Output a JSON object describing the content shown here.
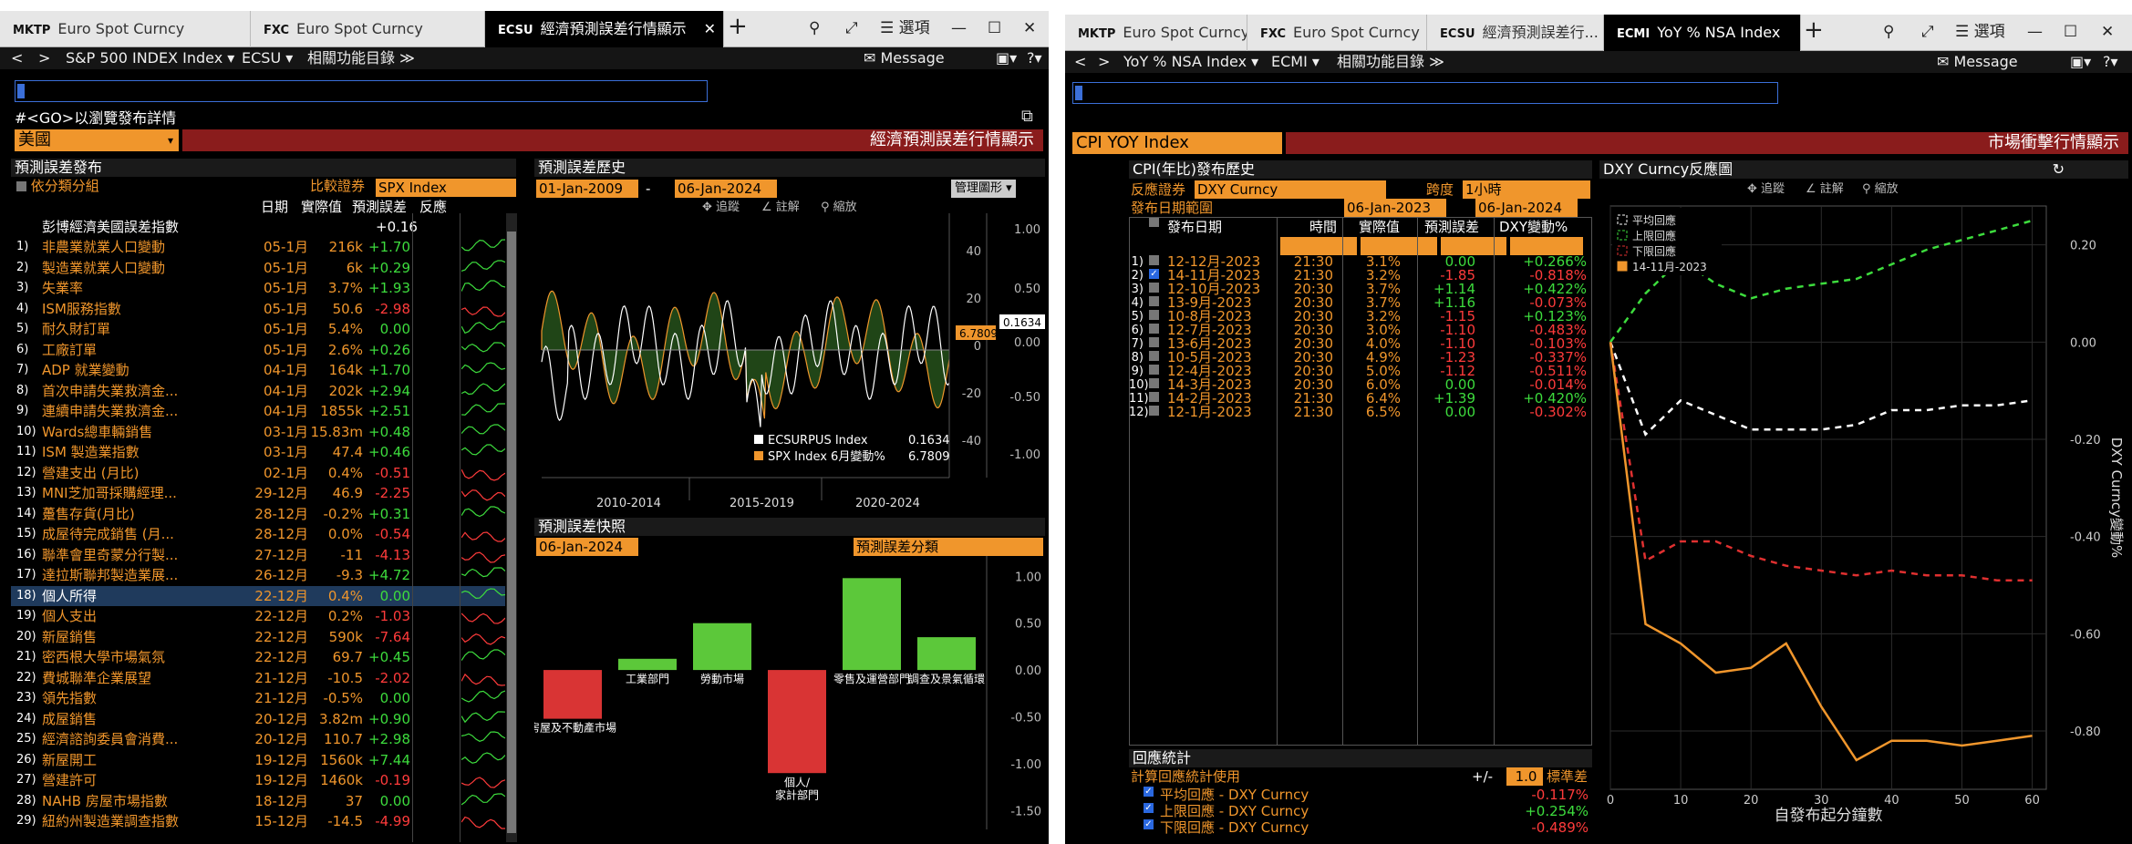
{
  "left": {
    "tabs": [
      {
        "code": "MKTP",
        "label": "Euro Spot Curncy"
      },
      {
        "code": "FXC",
        "label": "Euro Spot Curncy"
      },
      {
        "code": "ECSU",
        "label": "經濟預測誤差行情顯示"
      }
    ],
    "controls": {
      "search": "⚲",
      "expand": "⤢",
      "options": "☰ 選項",
      "min": "—",
      "max": "☐",
      "close": "✕"
    },
    "nav": {
      "back": "<",
      "fwd": ">",
      "security": "S&P 500 INDEX Index ▾",
      "fn": "ECSU ▾",
      "related": "相關功能目錄 ≫",
      "message": "✉ Message",
      "tools": "▣▾",
      "help": "?▾"
    },
    "hint": "#<GO>以瀏覽發布詳情",
    "country": "美國",
    "title": "經濟預測誤差行情顯示",
    "release_header": "預測誤差發布",
    "group_by": "依分類分組",
    "compare_label": "比較證券",
    "compare_value": "SPX Index",
    "columns": {
      "date": "日期",
      "actual": "實際值",
      "surprise": "預測誤差",
      "reaction": "反應"
    },
    "index_row": {
      "name": "彭博經濟美國誤差指數",
      "surprise": "+0.16"
    },
    "rows": [
      {
        "n": "1)",
        "name": "非農業就業人口變動",
        "date": "05-1月",
        "actual": "216k",
        "s": "+1.70",
        "c": "g"
      },
      {
        "n": "2)",
        "name": "製造業就業人口變動",
        "date": "05-1月",
        "actual": "6k",
        "s": "+0.29",
        "c": "g"
      },
      {
        "n": "3)",
        "name": "失業率",
        "date": "05-1月",
        "actual": "3.7%",
        "s": "+1.93",
        "c": "g"
      },
      {
        "n": "4)",
        "name": "ISM服務指數",
        "date": "05-1月",
        "actual": "50.6",
        "s": "-2.98",
        "c": "rd"
      },
      {
        "n": "5)",
        "name": "耐久財訂單",
        "date": "05-1月",
        "actual": "5.4%",
        "s": "0.00",
        "c": "g"
      },
      {
        "n": "6)",
        "name": "工廠訂單",
        "date": "05-1月",
        "actual": "2.6%",
        "s": "+0.26",
        "c": "g"
      },
      {
        "n": "7)",
        "name": "ADP 就業變動",
        "date": "04-1月",
        "actual": "164k",
        "s": "+1.70",
        "c": "g"
      },
      {
        "n": "8)",
        "name": "首次申請失業救濟金...",
        "date": "04-1月",
        "actual": "202k",
        "s": "+2.94",
        "c": "g"
      },
      {
        "n": "9)",
        "name": "連續申請失業救濟金...",
        "date": "04-1月",
        "actual": "1855k",
        "s": "+2.51",
        "c": "g"
      },
      {
        "n": "10)",
        "name": "Wards總車輛銷售",
        "date": "03-1月",
        "actual": "15.83m",
        "s": "+0.48",
        "c": "g"
      },
      {
        "n": "11)",
        "name": "ISM 製造業指數",
        "date": "03-1月",
        "actual": "47.4",
        "s": "+0.46",
        "c": "g"
      },
      {
        "n": "12)",
        "name": "營建支出 (月比)",
        "date": "02-1月",
        "actual": "0.4%",
        "s": "-0.51",
        "c": "rd"
      },
      {
        "n": "13)",
        "name": "MNI芝加哥採購經理...",
        "date": "29-12月",
        "actual": "46.9",
        "s": "-2.25",
        "c": "rd"
      },
      {
        "n": "14)",
        "name": "躉售存貨(月比)",
        "date": "28-12月",
        "actual": "-0.2%",
        "s": "+0.31",
        "c": "g"
      },
      {
        "n": "15)",
        "name": "成屋待完成銷售 (月...",
        "date": "28-12月",
        "actual": "0.0%",
        "s": "-0.54",
        "c": "rd"
      },
      {
        "n": "16)",
        "name": "聯準會里奇蒙分行製...",
        "date": "27-12月",
        "actual": "-11",
        "s": "-4.13",
        "c": "rd"
      },
      {
        "n": "17)",
        "name": "達拉斯聯邦製造業展...",
        "date": "26-12月",
        "actual": "-9.3",
        "s": "+4.72",
        "c": "g"
      },
      {
        "n": "18)",
        "name": "個人所得",
        "date": "22-12月",
        "actual": "0.4%",
        "s": "0.00",
        "c": "g",
        "sel": true
      },
      {
        "n": "19)",
        "name": "個人支出",
        "date": "22-12月",
        "actual": "0.2%",
        "s": "-1.03",
        "c": "rd"
      },
      {
        "n": "20)",
        "name": "新屋銷售",
        "date": "22-12月",
        "actual": "590k",
        "s": "-7.64",
        "c": "rd"
      },
      {
        "n": "21)",
        "name": "密西根大學市場氣氛",
        "date": "22-12月",
        "actual": "69.7",
        "s": "+0.45",
        "c": "g"
      },
      {
        "n": "22)",
        "name": "費城聯準企業展望",
        "date": "21-12月",
        "actual": "-10.5",
        "s": "-2.02",
        "c": "rd"
      },
      {
        "n": "23)",
        "name": "領先指數",
        "date": "21-12月",
        "actual": "-0.5%",
        "s": "0.00",
        "c": "g"
      },
      {
        "n": "24)",
        "name": "成屋銷售",
        "date": "20-12月",
        "actual": "3.82m",
        "s": "+0.90",
        "c": "g"
      },
      {
        "n": "25)",
        "name": "經濟諮詢委員會消費...",
        "date": "20-12月",
        "actual": "110.7",
        "s": "+2.98",
        "c": "g"
      },
      {
        "n": "26)",
        "name": "新屋開工",
        "date": "19-12月",
        "actual": "1560k",
        "s": "+7.44",
        "c": "g"
      },
      {
        "n": "27)",
        "name": "營建許可",
        "date": "19-12月",
        "actual": "1460k",
        "s": "-0.19",
        "c": "rd"
      },
      {
        "n": "28)",
        "name": "NAHB 房屋市場指數",
        "date": "18-12月",
        "actual": "37",
        "s": "0.00",
        "c": "g"
      },
      {
        "n": "29)",
        "name": "紐約州製造業調查指數",
        "date": "15-12月",
        "actual": "-14.5",
        "s": "-4.99",
        "c": "rd"
      }
    ],
    "history": {
      "header": "預測誤差歷史",
      "start": "01-Jan-2009",
      "end": "06-Jan-2024",
      "manage": "管理圖形 ▾",
      "tools": [
        "✥ 追蹤",
        "∠ 註解",
        "⚲ 縮放"
      ],
      "legend": [
        {
          "name": "ECSURPUS Index",
          "value": "0.1634",
          "color": "#ffffff"
        },
        {
          "name": "SPX Index 6月變動%",
          "value": "6.7809",
          "color": "#f0962c"
        }
      ],
      "badge_spx": "6.7809",
      "badge_ecs": "0.1634",
      "x_ticks": [
        "2010-2014",
        "2015-2019",
        "2020-2024"
      ],
      "left_ticks": [
        "40",
        "20",
        "0",
        "-20",
        "-40"
      ],
      "right_ticks": [
        "1.00",
        "0.50",
        "0.00",
        "-0.50",
        "-1.00"
      ]
    },
    "snapshot": {
      "header": "預測誤差快照",
      "date": "06-Jan-2024",
      "category": "預測誤差分類",
      "y_ticks": [
        "1.00",
        "0.50",
        "0.00",
        "-0.50",
        "-1.00",
        "-1.50"
      ]
    }
  },
  "right": {
    "tabs": [
      {
        "code": "MKTP",
        "label": "Euro Spot Curncy"
      },
      {
        "code": "FXC",
        "label": "Euro Spot Curncy"
      },
      {
        "code": "ECSU",
        "label": "經濟預測誤差行..."
      },
      {
        "code": "ECMI",
        "label": "YoY % NSA Index"
      }
    ],
    "nav": {
      "back": "<",
      "fwd": ">",
      "security": "YoY % NSA Index ▾",
      "fn": "ECMI ▾",
      "related": "相關功能目錄 ≫",
      "message": "✉ Message",
      "tools": "▣▾",
      "help": "?▾"
    },
    "security_title": "CPI YOY Index",
    "title": "市場衝擊行情顯示",
    "history_header": "CPI(年比)發布歷史",
    "reaction_label": "反應證券",
    "reaction_value": "DXY Curncy",
    "span_label": "跨度",
    "span_value": "1小時",
    "range_label": "發布日期範圍",
    "range_start": "06-Jan-2023",
    "range_end": "06-Jan-2024",
    "columns": {
      "date": "發布日期",
      "time": "時間",
      "actual": "實際值",
      "surprise": "預測誤差",
      "change": "DXY變動%"
    },
    "rows": [
      {
        "n": "1)",
        "chk": false,
        "date": "12-12月-2023",
        "time": "21:30",
        "actual": "3.1%",
        "s": "0.00",
        "sc": "g",
        "chg": "+0.266%",
        "cc": "g"
      },
      {
        "n": "2)",
        "chk": true,
        "date": "14-11月-2023",
        "time": "21:30",
        "actual": "3.2%",
        "s": "-1.85",
        "sc": "rd",
        "chg": "-0.818%",
        "cc": "rd"
      },
      {
        "n": "3)",
        "chk": false,
        "date": "12-10月-2023",
        "time": "20:30",
        "actual": "3.7%",
        "s": "+1.14",
        "sc": "g",
        "chg": "+0.422%",
        "cc": "g"
      },
      {
        "n": "4)",
        "chk": false,
        "date": "13-9月-2023",
        "time": "20:30",
        "actual": "3.7%",
        "s": "+1.16",
        "sc": "g",
        "chg": "-0.073%",
        "cc": "rd"
      },
      {
        "n": "5)",
        "chk": false,
        "date": "10-8月-2023",
        "time": "20:30",
        "actual": "3.2%",
        "s": "-1.15",
        "sc": "rd",
        "chg": "+0.123%",
        "cc": "g"
      },
      {
        "n": "6)",
        "chk": false,
        "date": "12-7月-2023",
        "time": "20:30",
        "actual": "3.0%",
        "s": "-1.10",
        "sc": "rd",
        "chg": "-0.483%",
        "cc": "rd"
      },
      {
        "n": "7)",
        "chk": false,
        "date": "13-6月-2023",
        "time": "20:30",
        "actual": "4.0%",
        "s": "-1.10",
        "sc": "rd",
        "chg": "-0.103%",
        "cc": "rd"
      },
      {
        "n": "8)",
        "chk": false,
        "date": "10-5月-2023",
        "time": "20:30",
        "actual": "4.9%",
        "s": "-1.23",
        "sc": "rd",
        "chg": "-0.337%",
        "cc": "rd"
      },
      {
        "n": "9)",
        "chk": false,
        "date": "12-4月-2023",
        "time": "20:30",
        "actual": "5.0%",
        "s": "-1.12",
        "sc": "rd",
        "chg": "-0.511%",
        "cc": "rd"
      },
      {
        "n": "10)",
        "chk": false,
        "date": "14-3月-2023",
        "time": "20:30",
        "actual": "6.0%",
        "s": "0.00",
        "sc": "g",
        "chg": "-0.014%",
        "cc": "rd"
      },
      {
        "n": "11)",
        "chk": false,
        "date": "14-2月-2023",
        "time": "21:30",
        "actual": "6.4%",
        "s": "+1.39",
        "sc": "g",
        "chg": "+0.420%",
        "cc": "g"
      },
      {
        "n": "12)",
        "chk": false,
        "date": "12-1月-2023",
        "time": "21:30",
        "actual": "6.5%",
        "s": "0.00",
        "sc": "g",
        "chg": "-0.302%",
        "cc": "rd"
      }
    ],
    "stats": {
      "header": "回應統計",
      "use_label": "計算回應統計使用",
      "pm": "+/-",
      "value": "1.0",
      "unit": "標準差",
      "items": [
        {
          "name": "平均回應 - DXY Curncy",
          "value": "-0.117%",
          "c": "rd"
        },
        {
          "name": "上限回應 - DXY Curncy",
          "value": "+0.254%",
          "c": "g"
        },
        {
          "name": "下限回應 - DXY Curncy",
          "value": "-0.489%",
          "c": "rd"
        }
      ]
    },
    "chart": {
      "header": "DXY Curncy反應圖",
      "tools": [
        "✥ 追蹤",
        "∠ 註解",
        "⚲ 縮放"
      ],
      "legend": [
        "平均回應",
        "上限回應",
        "下限回應",
        "14-11月-2023"
      ],
      "xlabel": "自發布起分鐘數",
      "ylabel": "DXY Curncy變動%",
      "y_ticks": [
        "0.20",
        "0.00",
        "-0.20",
        "-0.40",
        "-0.60",
        "-0.80"
      ],
      "x_ticks": [
        "0",
        "10",
        "20",
        "30",
        "40",
        "50",
        "60"
      ]
    }
  },
  "chart_data": [
    {
      "type": "bar",
      "title": "預測誤差快照",
      "categories": [
        "房屋及不動產市場",
        "工業部門",
        "勞動市場",
        "個人/家計部門",
        "零售及運營部門",
        "調查及景氣循環"
      ],
      "values": [
        -0.52,
        0.12,
        0.5,
        -1.1,
        0.98,
        0.35
      ],
      "ylim": [
        -1.7,
        1.1
      ]
    },
    {
      "type": "line",
      "title": "DXY Curncy反應圖",
      "xlabel": "自發布起分鐘數",
      "ylabel": "DXY Curncy變動%",
      "ylim": [
        -0.92,
        0.28
      ],
      "xlim": [
        0,
        62
      ],
      "x": [
        0,
        5,
        10,
        15,
        20,
        25,
        30,
        35,
        40,
        45,
        50,
        55,
        60
      ],
      "series": [
        {
          "name": "平均回應",
          "color": "#ffffff",
          "dash": true,
          "values": [
            0,
            -0.19,
            -0.12,
            -0.15,
            -0.18,
            -0.18,
            -0.18,
            -0.17,
            -0.14,
            -0.14,
            -0.13,
            -0.13,
            -0.12
          ]
        },
        {
          "name": "上限回應",
          "color": "#3ddc3d",
          "dash": true,
          "values": [
            0,
            0.1,
            0.17,
            0.12,
            0.09,
            0.11,
            0.12,
            0.13,
            0.16,
            0.19,
            0.21,
            0.23,
            0.25
          ]
        },
        {
          "name": "下限回應",
          "color": "#e03030",
          "dash": true,
          "values": [
            0,
            -0.45,
            -0.41,
            -0.41,
            -0.44,
            -0.46,
            -0.47,
            -0.48,
            -0.47,
            -0.48,
            -0.48,
            -0.49,
            -0.49
          ]
        },
        {
          "name": "14-11月-2023",
          "color": "#f0962c",
          "dash": false,
          "values": [
            0,
            -0.58,
            -0.62,
            -0.68,
            -0.67,
            -0.62,
            -0.75,
            -0.86,
            -0.82,
            -0.82,
            -0.83,
            -0.82,
            -0.81
          ]
        }
      ]
    },
    {
      "type": "line",
      "title": "預測誤差歷史",
      "x_range": [
        "2009",
        "2024"
      ],
      "series": [
        {
          "name": "ECSURPUS Index",
          "last": 0.1634
        },
        {
          "name": "SPX Index 6月變動%",
          "last": 6.7809
        }
      ]
    }
  ]
}
